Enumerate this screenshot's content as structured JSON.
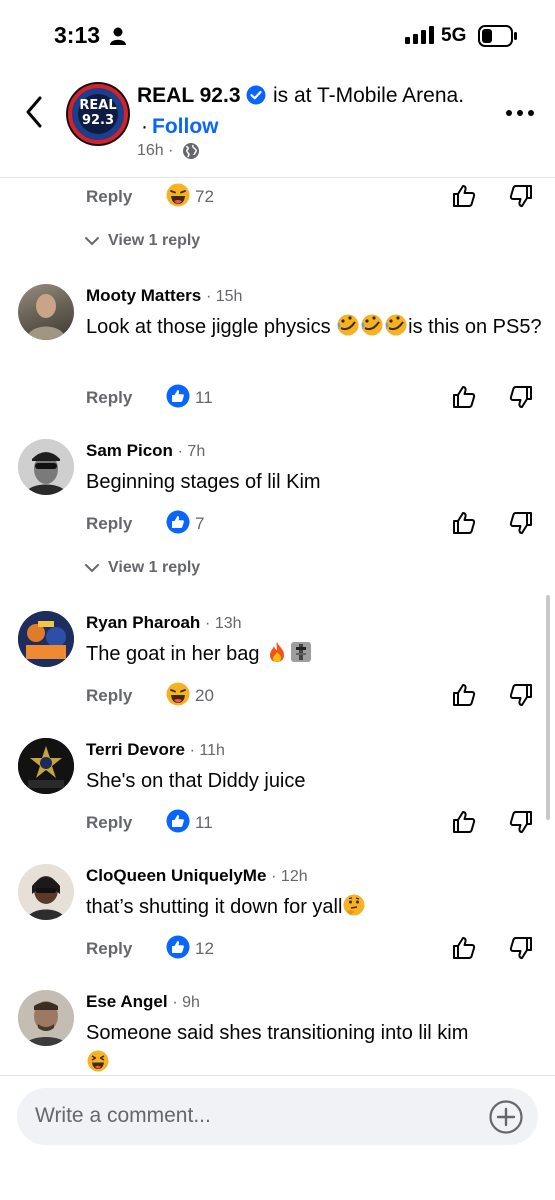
{
  "status_bar": {
    "time": "3:13",
    "network": "5G"
  },
  "header": {
    "page_name": "REAL 92.3",
    "location": "is at T-Mobile Arena.",
    "follow": "Follow",
    "follow_prefix": "·",
    "time_ago": "16h ·",
    "avatar_text": "REAL 92.3"
  },
  "top_row": {
    "reply": "Reply",
    "count": "72",
    "reaction": "haha-icon",
    "view_replies": "View 1 reply"
  },
  "comments": [
    {
      "name": "Mooty Matters",
      "time": "· 15h",
      "text_before": "Look at those jiggle physics ",
      "text_after": "is this on PS5?",
      "emoji": [
        "rofl",
        "rofl",
        "rofl"
      ],
      "reply": "Reply",
      "reaction": "like-icon",
      "count": "11"
    },
    {
      "name": "Sam Picon",
      "time": "· 7h",
      "text": "Beginning stages of lil Kim",
      "reply": "Reply",
      "reaction": "like-icon",
      "count": "7",
      "view_replies": "View 1 reply"
    },
    {
      "name": "Ryan Pharoah",
      "time": "· 13h",
      "text": "The goat in her bag ",
      "emoji": [
        "fire",
        "microphone"
      ],
      "reply": "Reply",
      "reaction": "haha-icon",
      "count": "20"
    },
    {
      "name": "Terri Devore",
      "time": "· 11h",
      "text": "She's on that Diddy juice",
      "reply": "Reply",
      "reaction": "like-icon",
      "count": "11"
    },
    {
      "name": "CloQueen UniquelyMe",
      "time": "· 12h",
      "text": "that’s shutting it down for yall",
      "emoji": [
        "thinking"
      ],
      "reply": "Reply",
      "reaction": "like-icon",
      "count": "12"
    },
    {
      "name": "Ese Angel",
      "time": "· 9h",
      "text": "Someone said shes transitioning into lil kim",
      "emoji": [
        "laughing"
      ]
    }
  ],
  "composer": {
    "placeholder": "Write a comment..."
  },
  "colors": {
    "accent": "#0866ff",
    "secondary_text": "#65676b",
    "reaction_yellow": "#f7b125"
  }
}
